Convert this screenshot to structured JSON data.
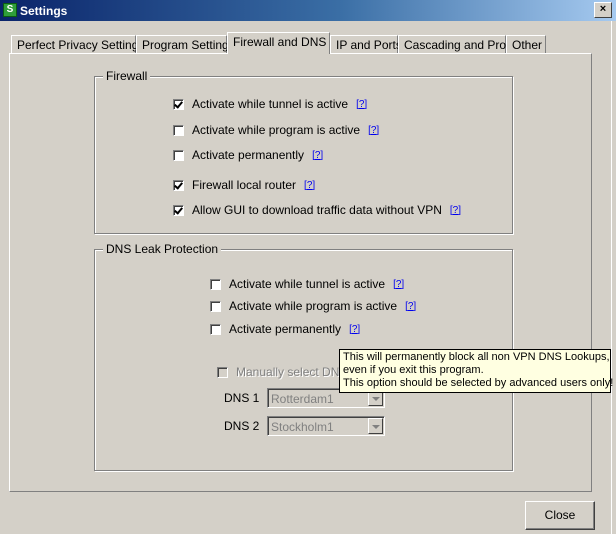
{
  "window": {
    "title": "Settings",
    "close_glyph": "×",
    "app_icon": "S"
  },
  "tabs": [
    {
      "label": "Perfect Privacy Settings"
    },
    {
      "label": "Program Settings"
    },
    {
      "label": "Firewall and DNS",
      "active": true
    },
    {
      "label": "IP and Ports"
    },
    {
      "label": "Cascading and Proxy"
    },
    {
      "label": "Other"
    }
  ],
  "firewall": {
    "title": "Firewall",
    "help": "[?]",
    "items": [
      {
        "label": "Activate while tunnel is active",
        "checked": true
      },
      {
        "label": "Activate while program is active",
        "checked": false
      },
      {
        "label": "Activate permanently",
        "checked": false
      },
      {
        "label": "Firewall local router",
        "checked": true
      },
      {
        "label": "Allow GUI to download traffic data without VPN",
        "checked": true
      }
    ]
  },
  "dns": {
    "title": "DNS Leak Protection",
    "help": "[?]",
    "items": [
      {
        "label": "Activate while tunnel is active",
        "checked": false
      },
      {
        "label": "Activate while program is active",
        "checked": false
      },
      {
        "label": "Activate permanently",
        "checked": false
      }
    ],
    "manual_label": "Manually select DNS",
    "dns1_label": "DNS 1",
    "dns1_value": "Rotterdam1",
    "dns2_label": "DNS 2",
    "dns2_value": "Stockholm1"
  },
  "tooltip": {
    "line1": "This will permanently block all non VPN DNS Lookups,",
    "line2": "even if you exit this program.",
    "line3": "This option should be selected by advanced users only!"
  },
  "close_button": "Close"
}
